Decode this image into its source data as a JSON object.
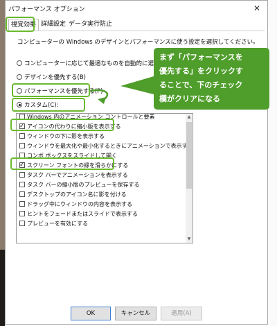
{
  "window": {
    "title": "パフォーマンス オプション",
    "close_glyph": "✕"
  },
  "tabs": [
    {
      "label": "視覚効果",
      "active": true
    },
    {
      "label": "詳細設定",
      "active": false
    },
    {
      "label": "データ実行防止",
      "active": false
    }
  ],
  "description": {
    "line1": "コンピューターの Windows のデザインとパフォーマンスに使う設定を選択してください。"
  },
  "radios": [
    {
      "label": "コンピューターに応じて最適なものを自動的に選択する(L)",
      "selected": false
    },
    {
      "label": "デザインを優先する(B)",
      "selected": false
    },
    {
      "label": "パフォーマンスを優先する(P)",
      "selected": false
    },
    {
      "label": "カスタム(C):",
      "selected": true
    }
  ],
  "effects": [
    {
      "label": "Windows 内のアニメーション コントロールと要素",
      "checked": false
    },
    {
      "label": "アイコンの代わりに縮小版を表示する",
      "checked": true
    },
    {
      "label": "ウィンドウの下に影を表示する",
      "checked": false
    },
    {
      "label": "ウィンドウを最大化や最小化するときにアニメーションで表示する",
      "checked": false
    },
    {
      "label": "コンボ ボックスをスライドして開く",
      "checked": false
    },
    {
      "label": "スクリーン フォントの縁を滑らかにする",
      "checked": true
    },
    {
      "label": "タスク バーでアニメーションを表示する",
      "checked": false
    },
    {
      "label": "タスク バーの縮小版のプレビューを保存する",
      "checked": false
    },
    {
      "label": "デスクトップのアイコン名に影を付ける",
      "checked": false
    },
    {
      "label": "ドラッグ中にウィンドウの内容を表示する",
      "checked": false
    },
    {
      "label": "ヒントをフェードまたはスライドで表示する",
      "checked": false
    },
    {
      "label": "プレビューを有効にする",
      "checked": false
    }
  ],
  "callout": {
    "lines": [
      "まず「パフォーマンスを",
      "優先する」をクリックす",
      "ることで、下のチェック",
      "欄がクリアになる"
    ]
  },
  "buttons": {
    "ok": "OK",
    "cancel": "キャンセル",
    "apply": "適用(A)"
  },
  "colors": {
    "highlight": "#6ab92f",
    "callout_bg": "#4f9d2b",
    "ok_border": "#3b7fd4"
  }
}
